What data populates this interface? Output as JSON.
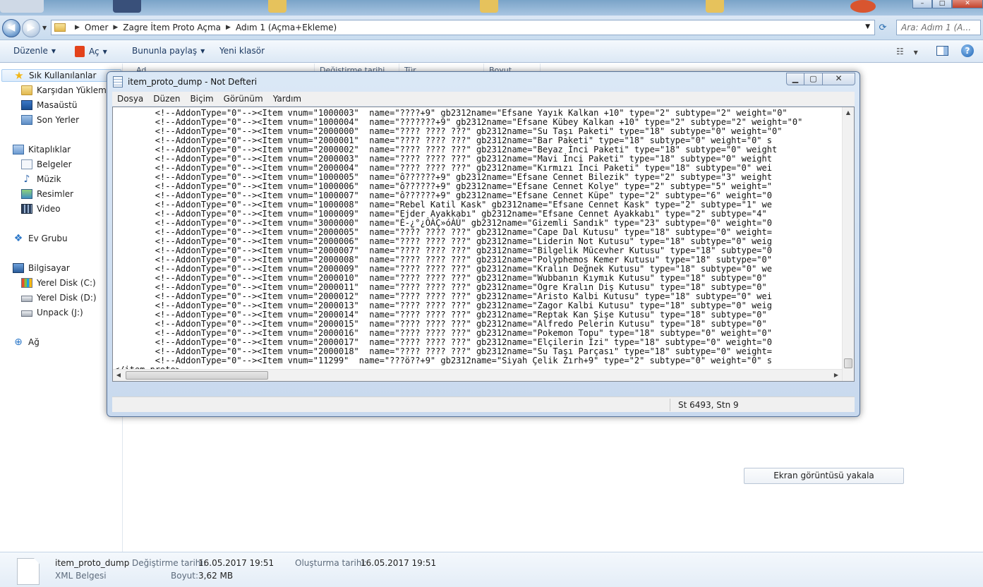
{
  "explorer": {
    "breadcrumb": [
      "Omer",
      "Zagre İtem Proto Açma",
      "Adım 1 (Açma+Ekleme)"
    ],
    "search_placeholder": "Ara: Adım 1 (A...",
    "toolbar": {
      "organize": "Düzenle",
      "open": "Aç",
      "share": "Bununla paylaş",
      "new_folder": "Yeni klasör"
    },
    "nav": {
      "favorites": "Sık Kullanılanlar",
      "downloads": "Karşıdan Yüklemeler",
      "desktop": "Masaüstü",
      "recent": "Son Yerler",
      "libraries": "Kitaplıklar",
      "documents": "Belgeler",
      "music": "Müzik",
      "pictures": "Resimler",
      "videos": "Video",
      "homegroup": "Ev Grubu",
      "computer": "Bilgisayar",
      "drive_c": "Yerel Disk (C:)",
      "drive_d": "Yerel Disk (D:)",
      "drive_j": "Unpack (J:)",
      "network": "Ağ"
    },
    "columns": [
      "Ad",
      "Değiştirme tarihi",
      "Tür",
      "Boyut"
    ],
    "details": {
      "file_name": "item_proto_dump",
      "file_type": "XML Belgesi",
      "modified_label": "Değiştirme tarihi:",
      "modified_value": "16.05.2017 19:51",
      "size_label": "Boyut:",
      "size_value": "3,62 MB",
      "created_label": "Oluşturma tarihi:",
      "created_value": "16.05.2017 19:51"
    },
    "capture_button": "Ekran görüntüsü yakala"
  },
  "notepad": {
    "title": "item_proto_dump - Not Defteri",
    "menu": [
      "Dosya",
      "Düzen",
      "Biçim",
      "Görünüm",
      "Yardım"
    ],
    "content": "        <!--AddonType=\"0\"--><Item vnum=\"1000003\"  name=\"????+9\" gb2312name=\"Efsane Yayık Kalkan +10\" type=\"2\" subtype=\"2\" weight=\"0\"\n        <!--AddonType=\"0\"--><Item vnum=\"1000004\"  name=\"???????+9\" gb2312name=\"Efsane Kübey Kalkan +10\" type=\"2\" subtype=\"2\" weight=\"0\"\n        <!--AddonType=\"0\"--><Item vnum=\"2000000\"  name=\"???? ???? ???\" gb2312name=\"Su Taşı Paketi\" type=\"18\" subtype=\"0\" weight=\"0\"\n        <!--AddonType=\"0\"--><Item vnum=\"2000001\"  name=\"???? ???? ???\" gb2312name=\"Bar Paketi\" type=\"18\" subtype=\"0\" weight=\"0\" s\n        <!--AddonType=\"0\"--><Item vnum=\"2000002\"  name=\"???? ???? ???\" gb2312name=\"Beyaz İnci Paketi\" type=\"18\" subtype=\"0\" weight\n        <!--AddonType=\"0\"--><Item vnum=\"2000003\"  name=\"???? ???? ???\" gb2312name=\"Mavi İnci Paketi\" type=\"18\" subtype=\"0\" weight\n        <!--AddonType=\"0\"--><Item vnum=\"2000004\"  name=\"???? ???? ???\" gb2312name=\"Kırmızı İnci Paketi\" type=\"18\" subtype=\"0\" wei\n        <!--AddonType=\"0\"--><Item vnum=\"1000005\"  name=\"ô??????+9\" gb2312name=\"Efsane Cennet Bilezik\" type=\"2\" subtype=\"3\" weight\n        <!--AddonType=\"0\"--><Item vnum=\"1000006\"  name=\"ô??????+9\" gb2312name=\"Efsane Cennet Kolye\" type=\"2\" subtype=\"5\" weight=\"\n        <!--AddonType=\"0\"--><Item vnum=\"1000007\"  name=\"ô??????+9\" gb2312name=\"Efsane Cennet Küpe\" type=\"2\" subtype=\"6\" weight=\"0\n        <!--AddonType=\"0\"--><Item vnum=\"1000008\"  name=\"Rebel Katil Kask\" gb2312name=\"Efsane Cennet Kask\" type=\"2\" subtype=\"1\" we\n        <!--AddonType=\"0\"--><Item vnum=\"1000009\"  name=\"Ejder Ayakkabı\" gb2312name=\"Efsane Cennet Ayakkabı\" type=\"2\" subtype=\"4\"\n        <!--AddonType=\"0\"--><Item vnum=\"3000000\"  name=\"È-¿°¿ÔÀÇ»óÀÚ\" gb2312name=\"Gizemli Sandık\" type=\"23\" subtype=\"0\" weight=\"0\n        <!--AddonType=\"0\"--><Item vnum=\"2000005\"  name=\"???? ???? ???\" gb2312name=\"Cape Dal Kutusu\" type=\"18\" subtype=\"0\" weight=\n        <!--AddonType=\"0\"--><Item vnum=\"2000006\"  name=\"???? ???? ???\" gb2312name=\"Liderin Not Kutusu\" type=\"18\" subtype=\"0\" weig\n        <!--AddonType=\"0\"--><Item vnum=\"2000007\"  name=\"???? ???? ???\" gb2312name=\"Bilgelik Mücevher Kutusu\" type=\"18\" subtype=\"0\n        <!--AddonType=\"0\"--><Item vnum=\"2000008\"  name=\"???? ???? ???\" gb2312name=\"Polyphemos Kemer Kutusu\" type=\"18\" subtype=\"0\"\n        <!--AddonType=\"0\"--><Item vnum=\"2000009\"  name=\"???? ???? ???\" gb2312name=\"Kralın Değnek Kutusu\" type=\"18\" subtype=\"0\" we\n        <!--AddonType=\"0\"--><Item vnum=\"2000010\"  name=\"???? ???? ???\" gb2312name=\"Wubbanın Kıymık Kutusu\" type=\"18\" subtype=\"0\"\n        <!--AddonType=\"0\"--><Item vnum=\"2000011\"  name=\"???? ???? ???\" gb2312name=\"Ogre Kralın Diş Kutusu\" type=\"18\" subtype=\"0\"\n        <!--AddonType=\"0\"--><Item vnum=\"2000012\"  name=\"???? ???? ???\" gb2312name=\"Aristo Kalbi Kutusu\" type=\"18\" subtype=\"0\" wei\n        <!--AddonType=\"0\"--><Item vnum=\"2000013\"  name=\"???? ???? ???\" gb2312name=\"Zagor Kalbi Kutusu\" type=\"18\" subtype=\"0\" weig\n        <!--AddonType=\"0\"--><Item vnum=\"2000014\"  name=\"???? ???? ???\" gb2312name=\"Reptak Kan Şişe Kutusu\" type=\"18\" subtype=\"0\"\n        <!--AddonType=\"0\"--><Item vnum=\"2000015\"  name=\"???? ???? ???\" gb2312name=\"Alfredo Pelerin Kutusu\" type=\"18\" subtype=\"0\"\n        <!--AddonType=\"0\"--><Item vnum=\"2000016\"  name=\"???? ???? ???\" gb2312name=\"Pokemon Topu\" type=\"18\" subtype=\"0\" weight=\"0\"\n        <!--AddonType=\"0\"--><Item vnum=\"2000017\"  name=\"???? ???? ???\" gb2312name=\"Elçilerin İzi\" type=\"18\" subtype=\"0\" weight=\"0\n        <!--AddonType=\"0\"--><Item vnum=\"2000018\"  name=\"???? ???? ???\" gb2312name=\"Su Taşı Parçası\" type=\"18\" subtype=\"0\" weight=\n        <!--AddonType=\"0\"--><Item vnum=\"11299\"  name=\"???ö??+9\" gb2312name=\"Siyah Çelik Zırh+9\" type=\"2\" subtype=\"0\" weight=\"0\" s\n</item_proto>",
    "status_position": "St 6493, Stn 9"
  }
}
